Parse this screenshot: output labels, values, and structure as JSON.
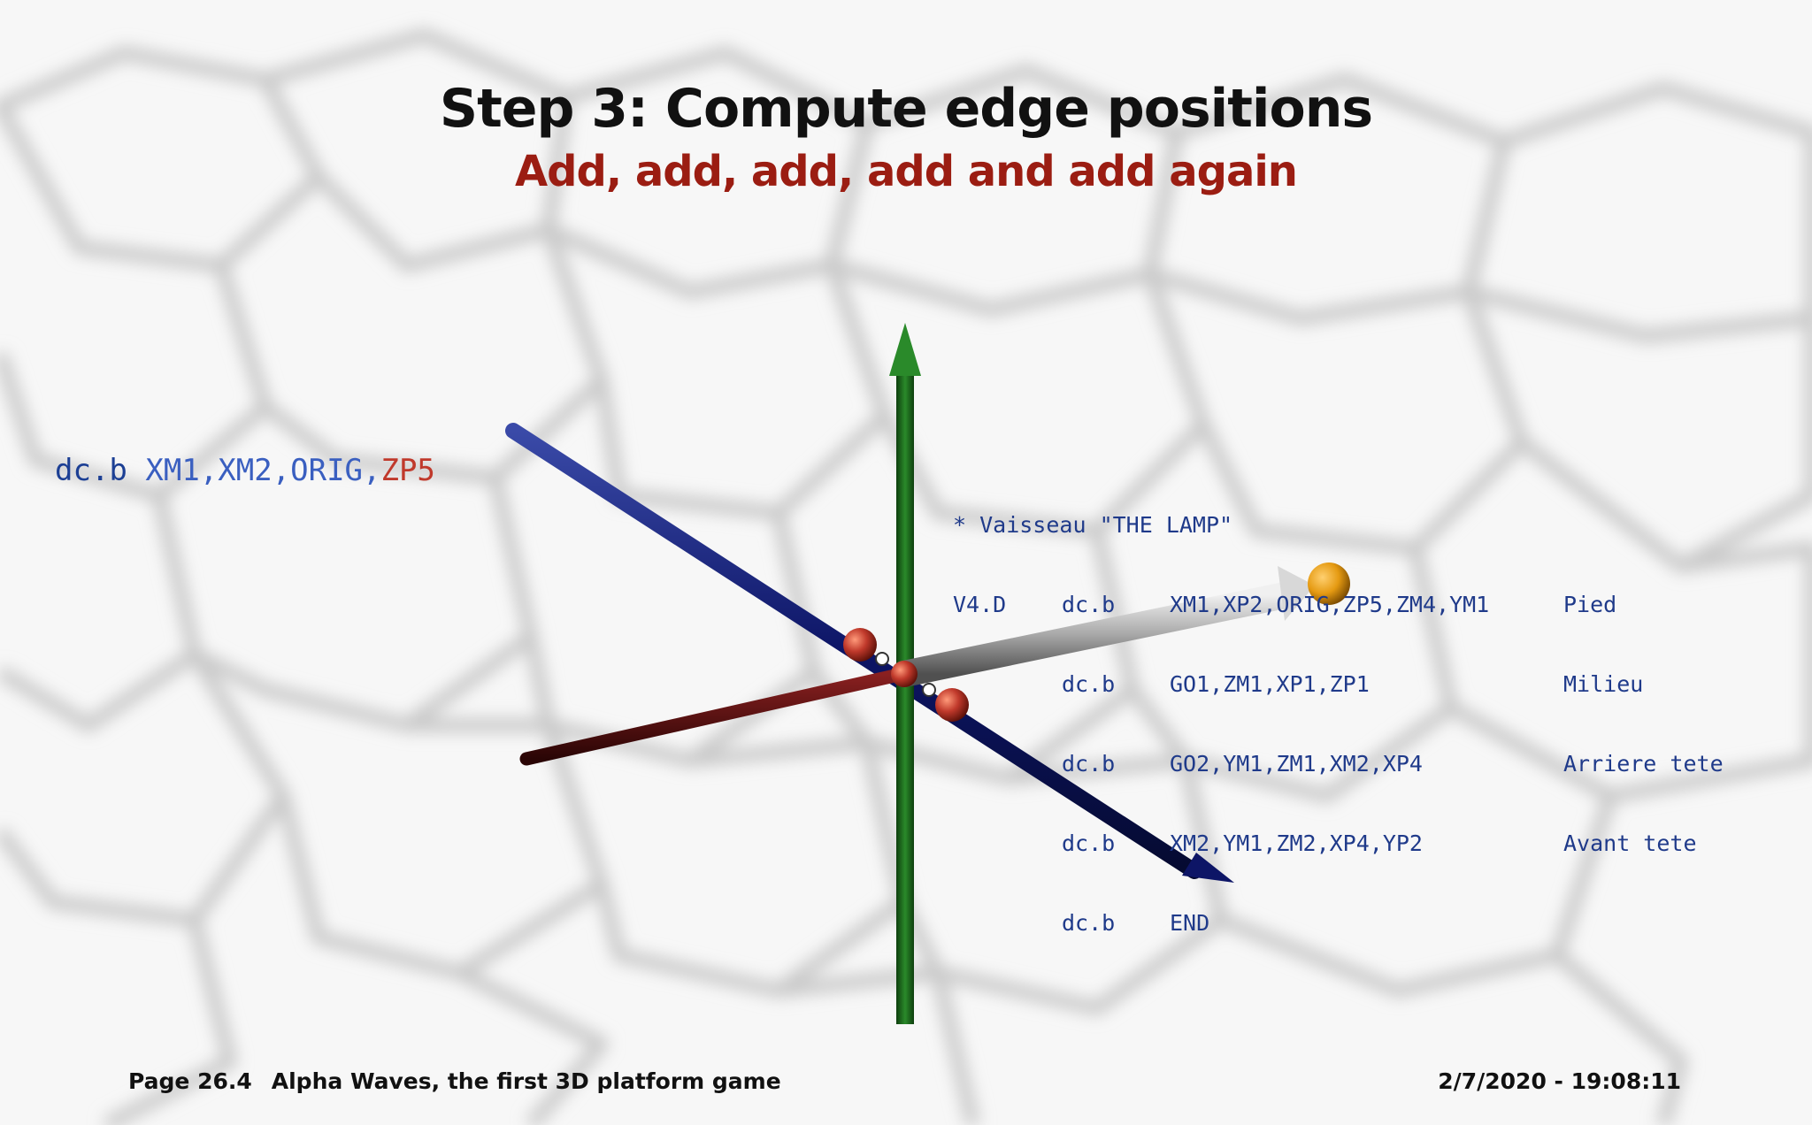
{
  "slide": {
    "title": "Step 3: Compute edge positions",
    "subtitle": "Add, add, add, add and add again"
  },
  "left_code": {
    "mnemonic": "dc.b",
    "args": "XM1,XM2,ORIG,",
    "highlight": "ZP5"
  },
  "listing": {
    "header": "* Vaisseau \"THE LAMP\"",
    "rows": [
      {
        "label": "V4.D",
        "mnemonic": "dc.b",
        "args": "XM1,XP2,ORIG,ZP5,ZM4,YM1",
        "comment": "Pied"
      },
      {
        "label": "",
        "mnemonic": "dc.b",
        "args": "GO1,ZM1,XP1,ZP1",
        "comment": "Milieu"
      },
      {
        "label": "",
        "mnemonic": "dc.b",
        "args": "GO2,YM1,ZM1,XM2,XP4",
        "comment": "Arriere tete"
      },
      {
        "label": "",
        "mnemonic": "dc.b",
        "args": "XM2,YM1,ZM2,XP4,YP2",
        "comment": "Avant tete"
      },
      {
        "label": "",
        "mnemonic": "dc.b",
        "args": "END",
        "comment": ""
      }
    ]
  },
  "colors": {
    "title": "#111111",
    "subtitle": "#9b1d12",
    "code": "#1f3a8a",
    "highlight": "#c0392b",
    "axis_x": "#0d1566",
    "axis_y": "#1e6a1e",
    "axis_z": "#5a1010",
    "edge_vector": "#cfcfcf",
    "vertex": "#c0392b",
    "endpoint": "#e59a12"
  },
  "footer": {
    "page": "Page 26.4",
    "doc_title": "Alpha Waves, the first 3D platform game",
    "timestamp": "2/7/2020 - 19:08:11"
  }
}
